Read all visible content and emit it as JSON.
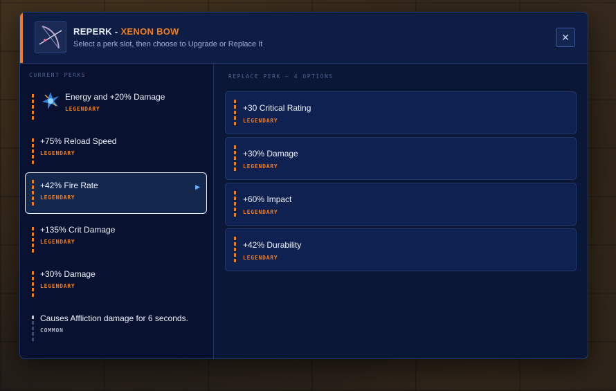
{
  "header": {
    "title": "REPERK",
    "separator": " - ",
    "weapon_name": "XENON BOW",
    "subtitle": "Select a perk slot, then choose to Upgrade or Replace It",
    "close_label": "✕"
  },
  "current_perks": {
    "label": "CURRENT PERKS",
    "items": [
      {
        "name": "Energy and +20% Damage",
        "rarity": "LEGENDARY"
      },
      {
        "name": "+75% Reload Speed",
        "rarity": "LEGENDARY"
      },
      {
        "name": "+42% Fire Rate",
        "rarity": "LEGENDARY",
        "selected": true
      },
      {
        "name": "+135% Crit Damage",
        "rarity": "LEGENDARY"
      },
      {
        "name": "+30% Damage",
        "rarity": "LEGENDARY"
      },
      {
        "name": "Causes Affliction damage for 6 seconds.",
        "rarity": "COMMON"
      }
    ]
  },
  "replace_perk": {
    "label": "REPLACE PERK — 4 OPTIONS",
    "options": [
      {
        "name": "+30 Critical Rating",
        "rarity": "LEGENDARY"
      },
      {
        "name": "+30% Damage",
        "rarity": "LEGENDARY"
      },
      {
        "name": "+60% Impact",
        "rarity": "LEGENDARY"
      },
      {
        "name": "+42% Durability",
        "rarity": "LEGENDARY"
      }
    ]
  },
  "colors": {
    "accent": "#f07d1e",
    "panel": "#0b1736",
    "selected_border": "#e6ecf8"
  }
}
